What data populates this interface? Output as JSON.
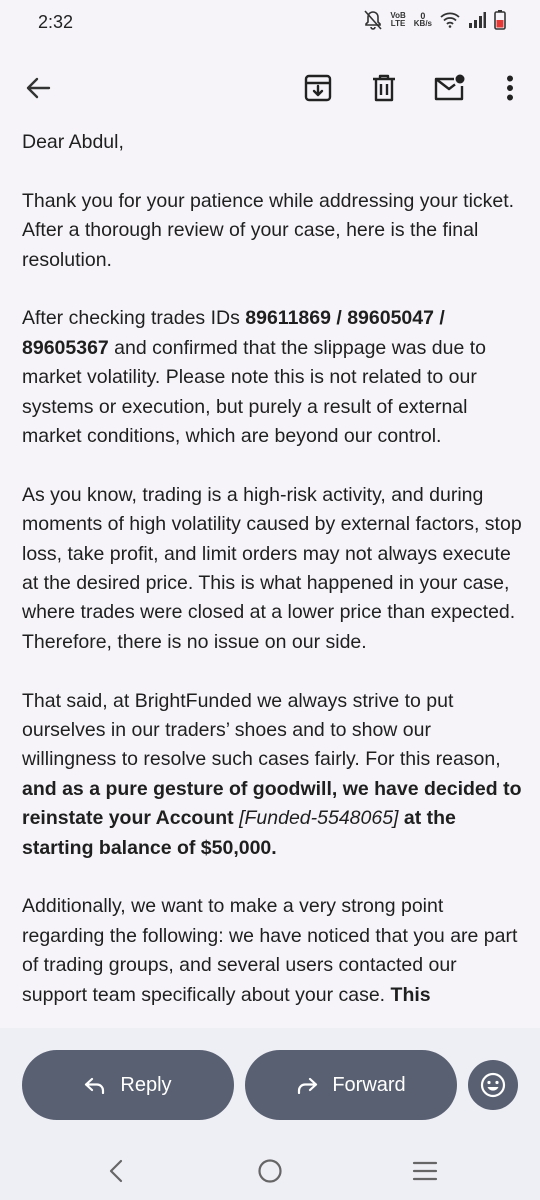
{
  "status_bar": {
    "time": "2:32",
    "volte_label": "VoB\nLTE",
    "data_rate_value": "0",
    "data_rate_unit": "KB/s"
  },
  "toolbar": {
    "icons": [
      "back-arrow-icon",
      "archive-icon",
      "trash-icon",
      "mark-unread-icon",
      "more-vert-icon"
    ]
  },
  "email": {
    "greeting": "Dear Abdul,",
    "p1": "Thank you for your patience while addressing your ticket. After a thorough review of your case, here is the final resolution.",
    "p2_a": "After checking trades IDs ",
    "p2_ids": "89611869 / 89605047 / 89605367",
    "p2_b": " and confirmed that the slippage was due to market volatility. Please note this is not related to our systems or execution, but purely a result of external market conditions, which are beyond our control.",
    "p3": "As you know, trading is a high-risk activity, and during moments of high volatility caused by external factors, stop loss, take profit, and limit orders may not always execute at the desired price. This is what happened in your case, where trades were closed at a lower price than expected. Therefore, there is no issue on our side.",
    "p4_a": "That said, at BrightFunded we always strive to put ourselves in our traders’ shoes and to show our willingness to resolve such cases fairly. For this reason, ",
    "p4_bold1": "and as a pure gesture of goodwill, we have decided to reinstate your Account",
    "p4_italic": "[Funded-5548065]",
    "p4_bold2": "at the starting balance of $50,000.",
    "p5_a": "Additionally, we want to make a very strong point regarding the following: we have noticed that you are part of trading groups, and several users contacted our support team specifically about your case. ",
    "p5_bold": "This"
  },
  "actions": {
    "reply_label": "Reply",
    "forward_label": "Forward"
  },
  "colors": {
    "background": "#f6f4f9",
    "pill": "#596072",
    "action_area": "#eeeef5"
  }
}
